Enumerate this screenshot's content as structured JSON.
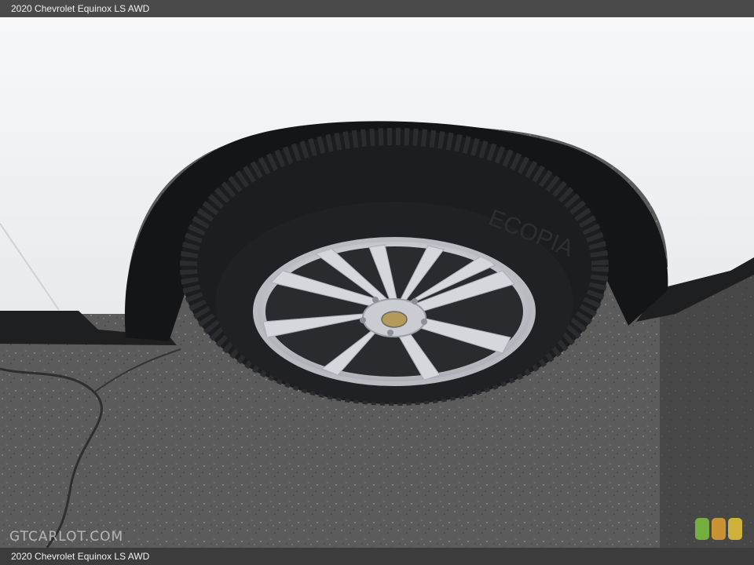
{
  "header": {
    "title": "2020 Chevrolet Equinox LS AWD"
  },
  "footer": {
    "caption": "2020 Chevrolet Equinox LS AWD"
  },
  "watermark": {
    "text": "GTCARLOT.COM"
  },
  "colors": {
    "body_white": "#f2f3f5",
    "tire_black": "#1c1d1f",
    "wheel_silver": "#c9ccd1",
    "asphalt": "#5a5a5a",
    "caption_bar": "#4a4a4a"
  }
}
